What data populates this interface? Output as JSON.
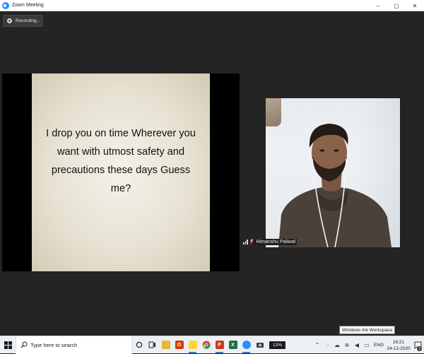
{
  "window": {
    "title": "Zoom Meeting",
    "controls": {
      "minimize": "–",
      "maximize": "▢",
      "close": "✕"
    }
  },
  "recording": {
    "label": "Recording..."
  },
  "share": {
    "slide_text": "I drop you on time Wherever you want with utmost safety and precautions these days Guess me?"
  },
  "participant": {
    "name": "Himanshu Paliwal",
    "muted": true
  },
  "tooltip": {
    "text": "Windows Ink Workspace"
  },
  "taskbar": {
    "search_placeholder": "Type here to search",
    "battery_label": "13%",
    "language": "ENG",
    "time": "16:21",
    "date": "24-12-2020",
    "notification_count": "3",
    "pinned_icons": [
      "cortana-icon",
      "task-view-icon",
      "file-explorer-icon",
      "office-icon",
      "sticky-notes-icon",
      "chrome-icon",
      "powerpoint-icon",
      "excel-icon",
      "zoom-icon",
      "camera-icon"
    ]
  },
  "colors": {
    "zoom_blue": "#2d8cff",
    "meeting_bg": "#242424",
    "taskbar": "#eceff4"
  }
}
